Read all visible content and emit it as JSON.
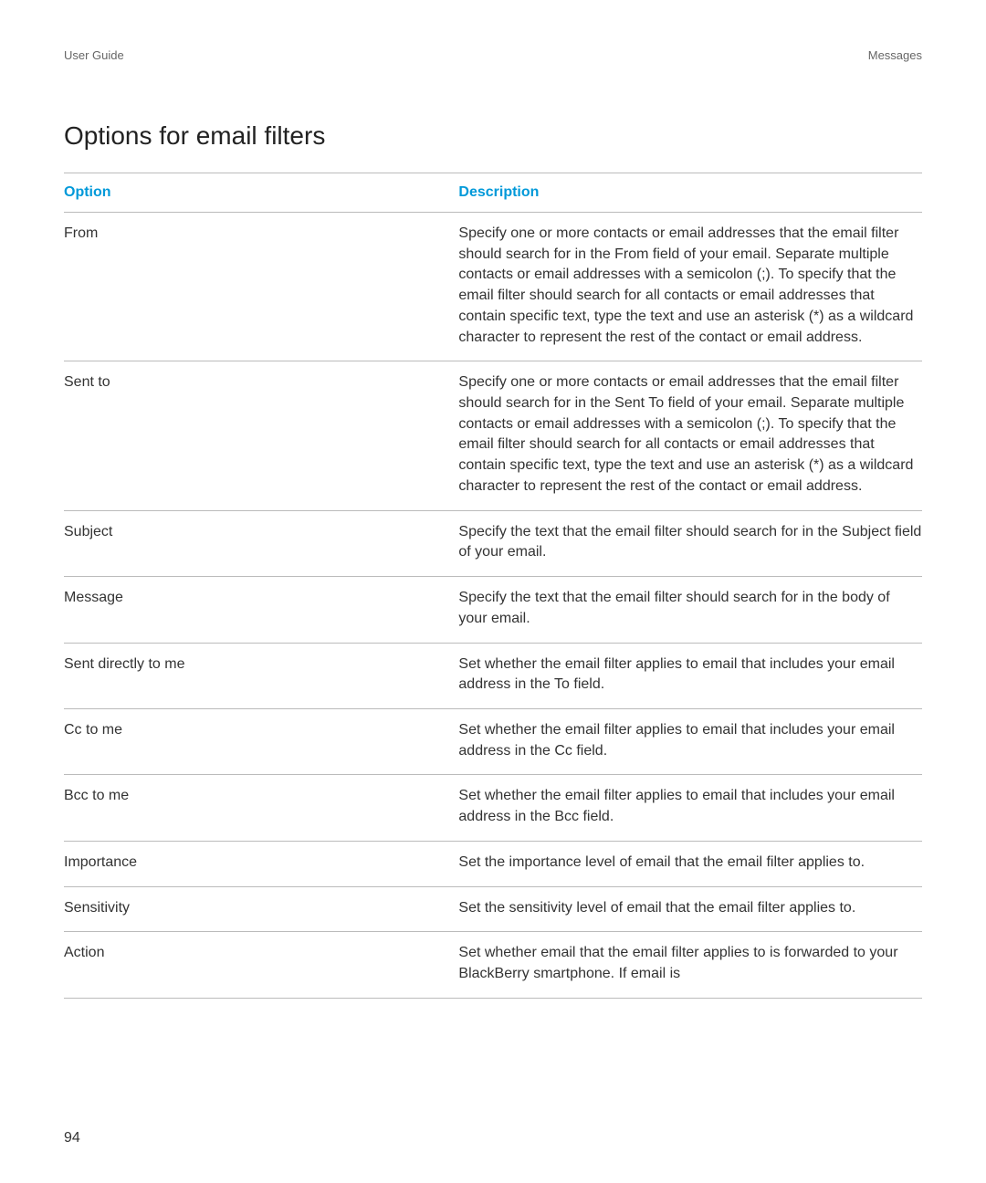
{
  "header": {
    "left": "User Guide",
    "right": "Messages"
  },
  "title": "Options for email filters",
  "table": {
    "headers": {
      "option": "Option",
      "description": "Description"
    },
    "rows": [
      {
        "option": "From",
        "description": "Specify one or more contacts or email addresses that the email filter should search for in the From field of your email. Separate multiple contacts or email addresses with a semicolon (;). To specify that the email filter should search for all contacts or email addresses that contain specific text, type the text and use an asterisk (*) as a wildcard character to represent the rest of the contact or email address."
      },
      {
        "option": "Sent to",
        "description": "Specify one or more contacts or email addresses that the email filter should search for in the Sent To field of your email. Separate multiple contacts or email addresses with a semicolon (;). To specify that the email filter should search for all contacts or email addresses that contain specific text, type the text and use an asterisk (*) as a wildcard character to represent the rest of the contact or email address."
      },
      {
        "option": "Subject",
        "description": "Specify the text that the email filter should search for in the Subject field of your email."
      },
      {
        "option": "Message",
        "description": "Specify the text that the email filter should search for in the body of your email."
      },
      {
        "option": "Sent directly to me",
        "description": "Set whether the email filter applies to email that includes your email address in the To field."
      },
      {
        "option": "Cc to me",
        "description": "Set whether the email filter applies to email that includes your email address in the Cc field."
      },
      {
        "option": "Bcc to me",
        "description": "Set whether the email filter applies to email that includes your email address in the Bcc field."
      },
      {
        "option": "Importance",
        "description": "Set the importance level of email that the email filter applies to."
      },
      {
        "option": "Sensitivity",
        "description": "Set the sensitivity level of email that the email filter applies to."
      },
      {
        "option": "Action",
        "description": "Set whether email that the email filter applies to is forwarded to your BlackBerry smartphone. If email is"
      }
    ]
  },
  "page_number": "94"
}
